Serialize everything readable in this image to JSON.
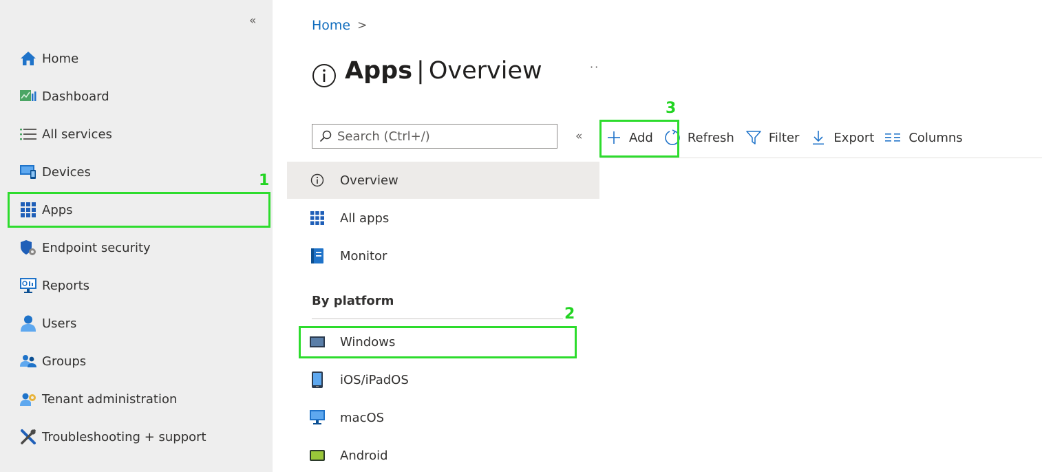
{
  "nav": {
    "collapse_glyph": "«",
    "items": [
      {
        "label": "Home",
        "icon": "home-icon"
      },
      {
        "label": "Dashboard",
        "icon": "dashboard-icon"
      },
      {
        "label": "All services",
        "icon": "list-icon"
      },
      {
        "label": "Devices",
        "icon": "devices-icon"
      },
      {
        "label": "Apps",
        "icon": "apps-grid-icon"
      },
      {
        "label": "Endpoint security",
        "icon": "shield-gear-icon"
      },
      {
        "label": "Reports",
        "icon": "reports-monitor-icon"
      },
      {
        "label": "Users",
        "icon": "user-icon"
      },
      {
        "label": "Groups",
        "icon": "groups-icon"
      },
      {
        "label": "Tenant administration",
        "icon": "tenant-admin-icon"
      },
      {
        "label": "Troubleshooting + support",
        "icon": "tools-icon"
      }
    ]
  },
  "breadcrumb": {
    "home": "Home",
    "separator": ">"
  },
  "page": {
    "title_bold": "Apps",
    "title_separator": "|",
    "title_rest": "Overview",
    "more": "··"
  },
  "search": {
    "placeholder": "Search (Ctrl+/)",
    "collapse_glyph": "«"
  },
  "menu": {
    "items": [
      {
        "label": "Overview",
        "icon": "info-icon"
      },
      {
        "label": "All apps",
        "icon": "apps-grid-icon"
      },
      {
        "label": "Monitor",
        "icon": "monitor-book-icon"
      }
    ],
    "section_title": "By platform",
    "platforms": [
      {
        "label": "Windows",
        "icon": "windows-laptop-icon"
      },
      {
        "label": "iOS/iPadOS",
        "icon": "tablet-icon"
      },
      {
        "label": "macOS",
        "icon": "desktop-monitor-icon"
      },
      {
        "label": "Android",
        "icon": "android-device-icon"
      }
    ]
  },
  "toolbar": {
    "add": "Add",
    "refresh": "Refresh",
    "filter": "Filter",
    "export": "Export",
    "columns": "Columns"
  },
  "annotations": {
    "step1": "1",
    "step2": "2",
    "step3": "3"
  },
  "colors": {
    "accent": "#0f6cbd",
    "highlight": "#2ddc2d",
    "nav_background": "#eeeeee",
    "selected_background": "#edebe9"
  }
}
